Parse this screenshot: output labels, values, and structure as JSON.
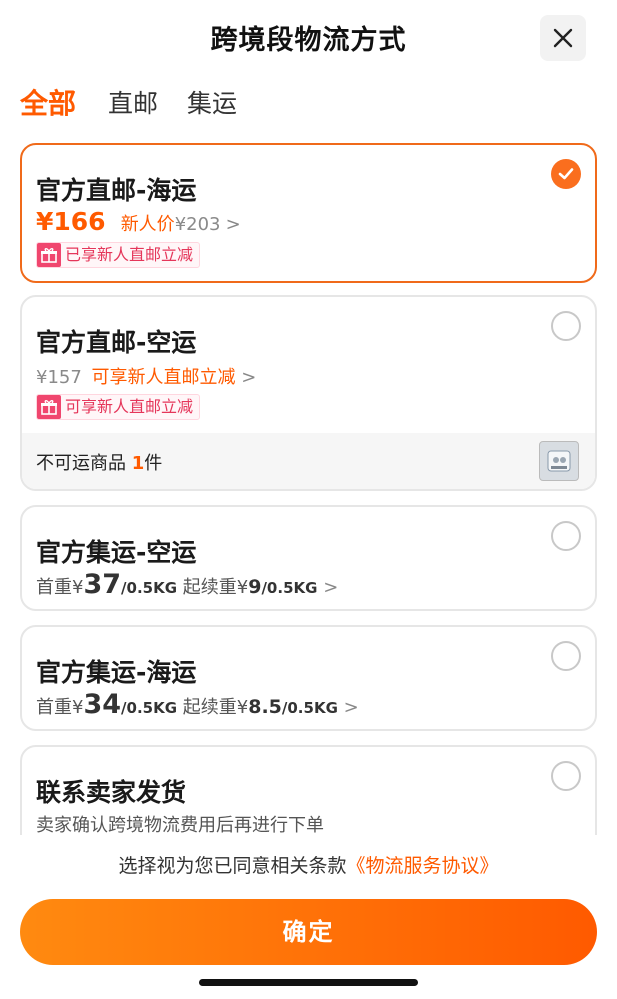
{
  "header": {
    "title": "跨境段物流方式",
    "close_icon": "close-icon"
  },
  "tabs": [
    {
      "label": "全部",
      "active": true
    },
    {
      "label": "直邮",
      "active": false
    },
    {
      "label": "集运",
      "active": false
    }
  ],
  "options": [
    {
      "title": "官方直邮-海运",
      "selected": true,
      "price": "¥166",
      "new_price_label": "新人价",
      "original_price": "¥203",
      "chevron": ">",
      "promo_tag": "已享新人直邮立减"
    },
    {
      "title": "官方直邮-空运",
      "selected": false,
      "price": "¥157",
      "promo_text": "可享新人直邮立减",
      "chevron": ">",
      "promo_tag": "可享新人直邮立减",
      "unavailable_label": "不可运商品",
      "unavailable_count": "1",
      "unavailable_unit": "件"
    },
    {
      "title": "官方集运-空运",
      "selected": false,
      "first_weight_label": "首重¥",
      "first_weight_price": "37",
      "first_weight_unit": "/0.5KG",
      "extra_weight_label": "起续重¥",
      "extra_weight_price": "9",
      "extra_weight_unit": "/0.5KG",
      "chevron": ">"
    },
    {
      "title": "官方集运-海运",
      "selected": false,
      "first_weight_label": "首重¥",
      "first_weight_price": "34",
      "first_weight_unit": "/0.5KG",
      "extra_weight_label": "起续重¥",
      "extra_weight_price": "8.5",
      "extra_weight_unit": "/0.5KG",
      "chevron": ">"
    },
    {
      "title": "联系卖家发货",
      "selected": false,
      "description": "卖家确认跨境物流费用后再进行下单"
    }
  ],
  "footer": {
    "agree_text": "选择视为您已同意相关条款",
    "agreement_link": "《物流服务协议》",
    "confirm_label": "确定"
  },
  "colors": {
    "accent": "#ff5a00",
    "promo": "#e5365a"
  }
}
